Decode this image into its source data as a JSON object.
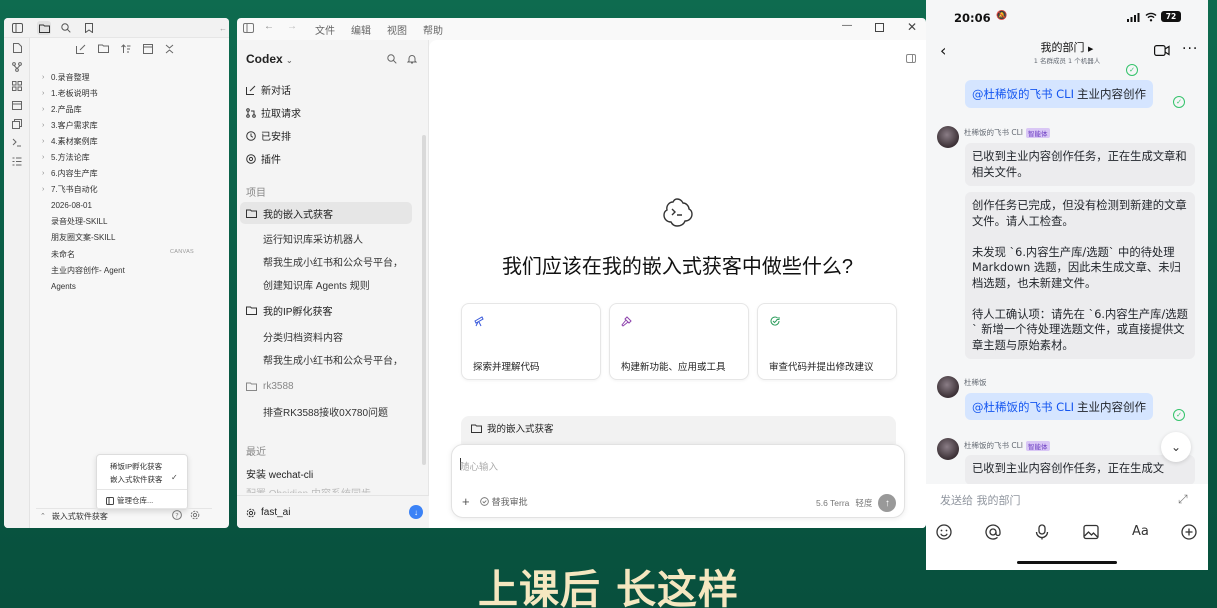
{
  "obsidian": {
    "tree": [
      {
        "label": "0.录音整理",
        "type": "folder"
      },
      {
        "label": "1.老板说明书",
        "type": "folder"
      },
      {
        "label": "2.产品库",
        "type": "folder"
      },
      {
        "label": "3.客户需求库",
        "type": "folder"
      },
      {
        "label": "4.素材案例库",
        "type": "folder"
      },
      {
        "label": "5.方法论库",
        "type": "folder"
      },
      {
        "label": "6.内容生产库",
        "type": "folder"
      },
      {
        "label": "7.飞书自动化",
        "type": "folder"
      },
      {
        "label": "2026-08-01",
        "type": "file"
      },
      {
        "label": "录音处理-SKILL",
        "type": "file"
      },
      {
        "label": "朋友圈文案-SKILL",
        "type": "file"
      },
      {
        "label": "未命名",
        "type": "file"
      },
      {
        "label": "主业内容创作- Agent",
        "type": "file"
      },
      {
        "label": "Agents",
        "type": "file"
      }
    ],
    "canvas_tag": "CANVAS",
    "vault_menu": {
      "item1": "稀饭IP孵化获客",
      "item2": "嵌入式软件获客",
      "manage": "管理仓库..."
    },
    "current_vault": "嵌入式软件获客"
  },
  "codex": {
    "menu": {
      "file": "文件",
      "edit": "编辑",
      "view": "视图",
      "help": "帮助"
    },
    "brand": "Codex",
    "nav": {
      "new_chat": "新对话",
      "pull_request": "拉取请求",
      "scheduled": "已安排",
      "plugins": "插件"
    },
    "projects_label": "项目",
    "projects": [
      {
        "name": "我的嵌入式获客",
        "threads": [
          "运行知识库采访机器人",
          "帮我生成小红书和公众号平台，",
          "创建知识库 Agents 规则"
        ]
      },
      {
        "name": "我的IP孵化获客",
        "threads": [
          "分类归档资料内容",
          "帮我生成小红书和公众号平台，"
        ]
      },
      {
        "name": "rk3588",
        "threads": [
          "排查RK3588接收0X780问题"
        ]
      }
    ],
    "recent_label": "最近",
    "recent": [
      "安装 wechat-cli",
      "配置 Obsidian 内容系统同步"
    ],
    "account": "fast_ai",
    "hero": "我们应该在我的嵌入式获客中做些什么?",
    "cards": [
      {
        "label": "探索并理解代码",
        "icon": "telescope-icon"
      },
      {
        "label": "构建新功能、应用或工具",
        "icon": "hammer-icon"
      },
      {
        "label": "审查代码并提出修改建议",
        "icon": "review-icon"
      }
    ],
    "context_project": "我的嵌入式获客",
    "composer": {
      "placeholder": "随心输入",
      "approval": "替我审批",
      "model": "5.6 Terra",
      "effort": "轻度"
    }
  },
  "feishu": {
    "status": {
      "time": "20:06",
      "battery": "72"
    },
    "header": {
      "title": "我的部门",
      "subtitle": "1 名群成员  1 个机器人"
    },
    "messages": [
      {
        "kind": "mention",
        "mention": "@杜稀饭的飞书 CLI",
        "text": "主业内容创作"
      },
      {
        "kind": "bot",
        "sender": "杜稀饭的飞书 CLI",
        "tag": "智能体",
        "bubbles": [
          "已收到主业内容创作任务，正在生成文章和相关文件。",
          "创作任务已完成，但没有检测到新建的文章文件。请人工检查。\n\n未发现 `6.内容生产库/选题` 中的待处理 Markdown 选题，因此未生成文章、未归档选题，也未新建文件。\n\n待人工确认项：请先在 `6.内容生产库/选题` 新增一个待处理选题文件，或直接提供文章主题与原始素材。"
        ]
      },
      {
        "kind": "user",
        "sender": "杜稀饭",
        "mention": "@杜稀饭的飞书 CLI",
        "text": "主业内容创作"
      },
      {
        "kind": "bot",
        "sender": "杜稀饭的飞书 CLI",
        "tag": "智能体",
        "bubbles": [
          "已收到主业内容创作任务，正在生成文"
        ]
      }
    ],
    "input_placeholder": "发送给 我的部门"
  },
  "caption": "上课后 长这样"
}
